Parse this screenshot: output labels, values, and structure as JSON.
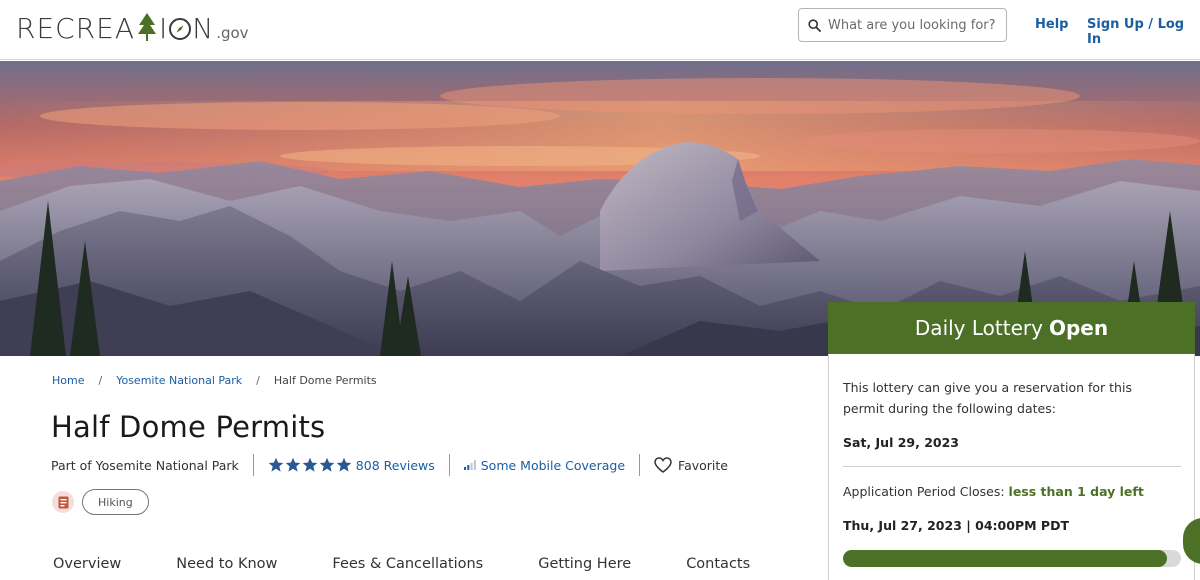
{
  "header": {
    "logo_left": "RECREA",
    "logo_mid": "I",
    "logo_right": "N",
    "logo_suffix": ".gov",
    "search_placeholder": "What are you looking for?",
    "help_label": "Help",
    "signup_label": "Sign Up / Log In"
  },
  "breadcrumb": [
    {
      "label": "Home"
    },
    {
      "label": "Yosemite National Park"
    },
    {
      "label": "Half Dome Permits"
    }
  ],
  "breadcrumb_sep": "/",
  "page": {
    "title": "Half Dome Permits",
    "parent": "Part of Yosemite National Park",
    "rating": 5,
    "reviews": "808 Reviews",
    "coverage": "Some Mobile Coverage",
    "favorite": "Favorite",
    "tag": "Hiking"
  },
  "tabs": [
    {
      "label": "Overview"
    },
    {
      "label": "Need to Know"
    },
    {
      "label": "Fees & Cancellations"
    },
    {
      "label": "Getting Here"
    },
    {
      "label": "Contacts"
    }
  ],
  "lottery": {
    "heading_prefix": "Daily Lottery",
    "heading_status": "Open",
    "intro": "This lottery can give you a reservation for this permit during the following dates:",
    "date": "Sat, Jul 29, 2023",
    "closes_label": "Application Period Closes:",
    "closes_value": "less than 1 day left",
    "deadline": "Thu, Jul 27, 2023 | 04:00PM PDT",
    "progress": 0.96
  },
  "colors": {
    "brand_green": "#4c7126",
    "link_blue": "#1b5ea1",
    "star_blue": "#2b5797"
  }
}
